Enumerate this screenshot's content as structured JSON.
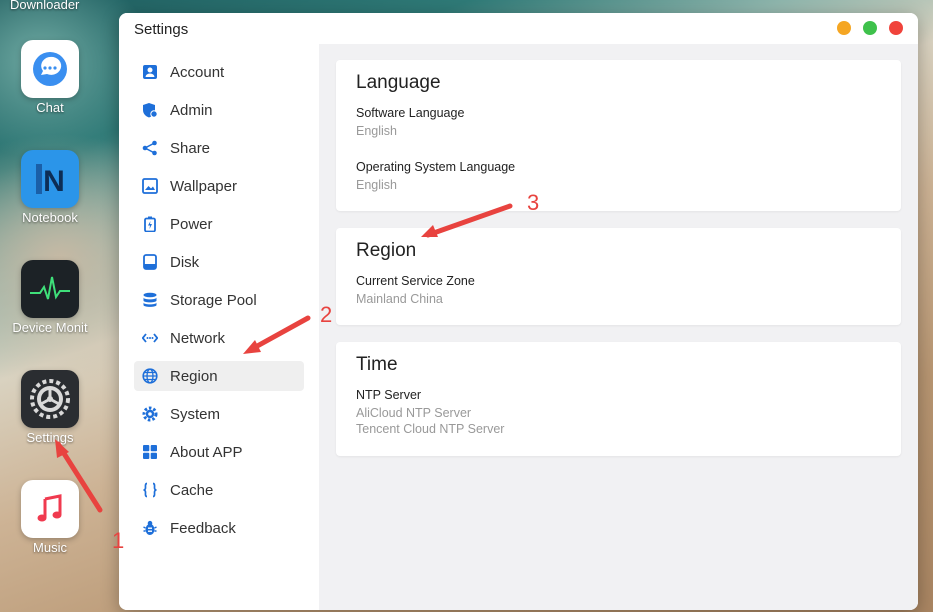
{
  "desktop": {
    "top_label": "Downloader",
    "apps": [
      {
        "label": "Chat",
        "icon": "chat-icon"
      },
      {
        "label": "Notebook",
        "icon": "notebook-icon"
      },
      {
        "label": "Device Monit",
        "icon": "device-monitor-icon"
      },
      {
        "label": "Settings",
        "icon": "gear-icon"
      },
      {
        "label": "Music",
        "icon": "music-note-icon"
      }
    ]
  },
  "window": {
    "title": "Settings",
    "controls": {
      "minimize": "#f5a623",
      "maximize": "#3ec14b",
      "close": "#f0433b"
    }
  },
  "sidebar": {
    "items": [
      {
        "label": "Account",
        "icon": "account-icon"
      },
      {
        "label": "Admin",
        "icon": "admin-shield-icon"
      },
      {
        "label": "Share",
        "icon": "share-icon"
      },
      {
        "label": "Wallpaper",
        "icon": "wallpaper-icon"
      },
      {
        "label": "Power",
        "icon": "battery-icon"
      },
      {
        "label": "Disk",
        "icon": "disk-icon"
      },
      {
        "label": "Storage Pool",
        "icon": "database-icon"
      },
      {
        "label": "Network",
        "icon": "network-icon"
      },
      {
        "label": "Region",
        "icon": "globe-icon"
      },
      {
        "label": "System",
        "icon": "gear-icon"
      },
      {
        "label": "About APP",
        "icon": "grid-icon"
      },
      {
        "label": "Cache",
        "icon": "braces-icon"
      },
      {
        "label": "Feedback",
        "icon": "bug-icon"
      }
    ],
    "active": "Region",
    "accent": "#1e6fd9"
  },
  "language_card": {
    "title": "Language",
    "software_label": "Software Language",
    "software_value": "English",
    "os_label": "Operating System Language",
    "os_value": "English"
  },
  "region_card": {
    "title": "Region",
    "zone_label": "Current Service Zone",
    "zone_value": "Mainland China"
  },
  "time_card": {
    "title": "Time",
    "ntp_label": "NTP Server",
    "ntp_servers": [
      "AliCloud NTP Server",
      "Tencent Cloud NTP Server"
    ]
  },
  "annotations": [
    "1",
    "2",
    "3"
  ]
}
